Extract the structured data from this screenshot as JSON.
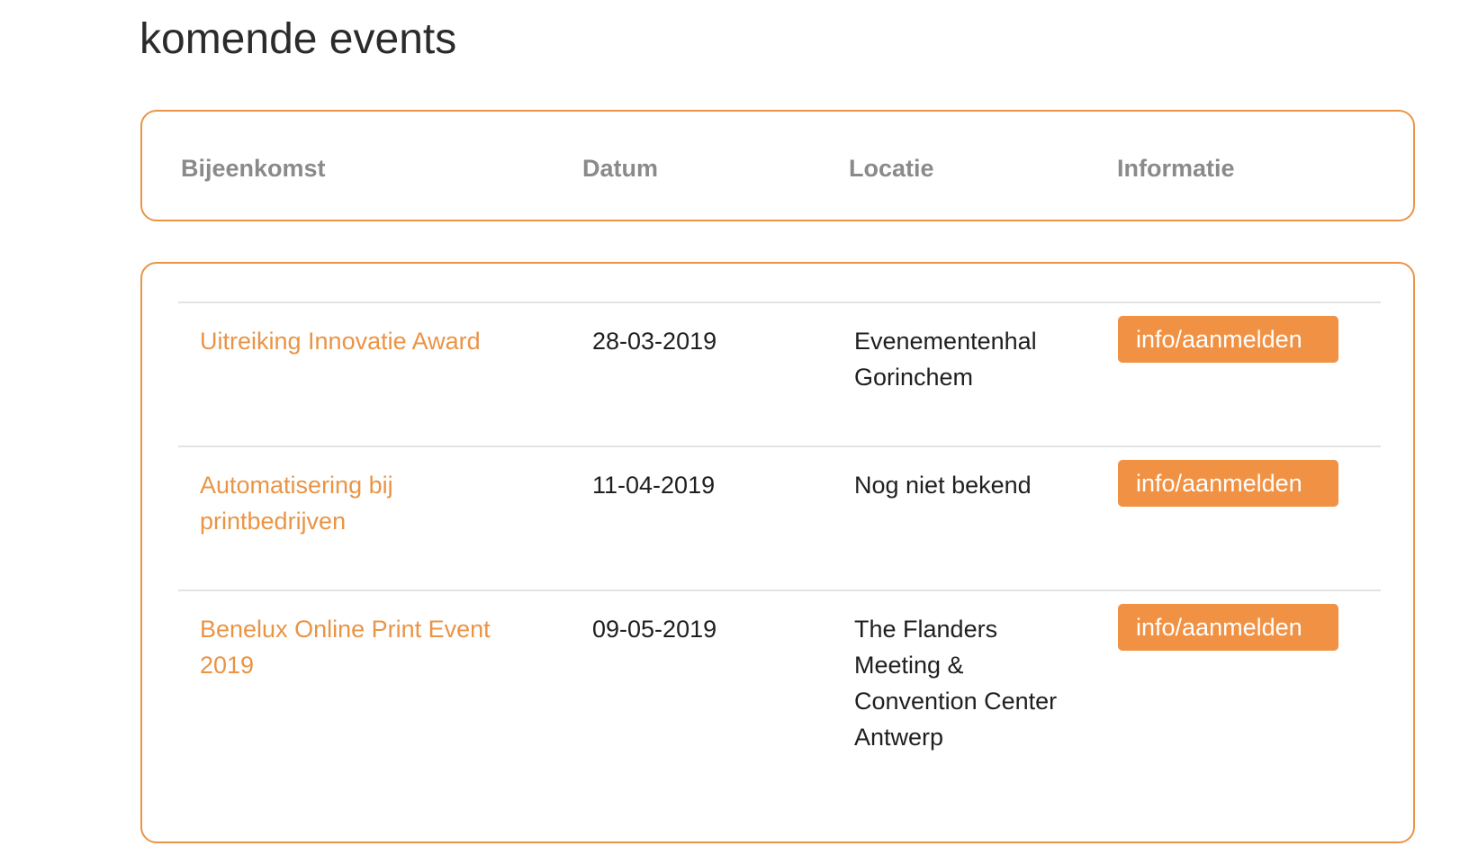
{
  "page": {
    "title": "komende events"
  },
  "table": {
    "headers": [
      "Bijeenkomst",
      "Datum",
      "Locatie",
      "Informatie"
    ],
    "rows": [
      {
        "name": "Uitreiking Innovatie Award",
        "date": "28-03-2019",
        "location": "Evenementenhal Gorinchem",
        "button_label": "info/aanmelden"
      },
      {
        "name": "Automatisering bij printbedrijven",
        "date": "11-04-2019",
        "location": "Nog niet bekend",
        "button_label": "info/aanmelden"
      },
      {
        "name": "Benelux Online Print Event 2019",
        "date": "09-05-2019",
        "location": "The Flanders Meeting & Convention Center Antwerp",
        "button_label": "info/aanmelden"
      }
    ]
  },
  "colors": {
    "accent": "#ea9445",
    "button_bg": "#f19143",
    "header_text": "#8a8a8a",
    "row_divider": "#e3e3e3"
  }
}
